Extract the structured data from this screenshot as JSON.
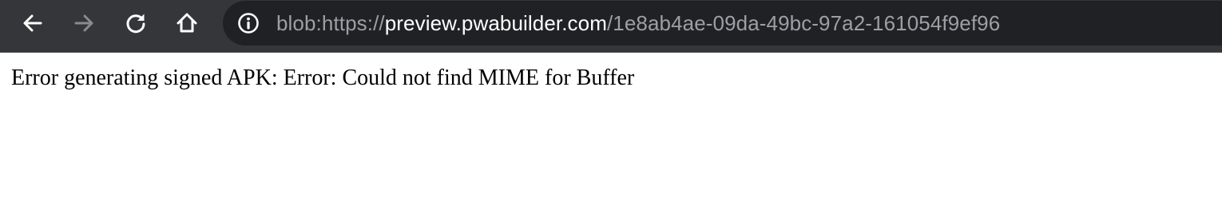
{
  "browser": {
    "url": {
      "scheme_prefix": "blob:https://",
      "host": "preview.pwabuilder.com",
      "path": "/1e8ab4ae-09da-49bc-97a2-161054f9ef96"
    },
    "icons": {
      "back": "arrow-left-icon",
      "forward": "arrow-right-icon",
      "reload": "reload-icon",
      "home": "home-icon",
      "site_info": "info-circle-icon"
    },
    "colors": {
      "toolbar_bg": "#35363a",
      "omnibox_bg": "#202124",
      "url_dim": "#9aa0a6",
      "url_host": "#ffffff",
      "forward_disabled": "#8a8b8d"
    }
  },
  "page": {
    "message": "Error generating signed APK: Error: Could not find MIME for Buffer"
  }
}
